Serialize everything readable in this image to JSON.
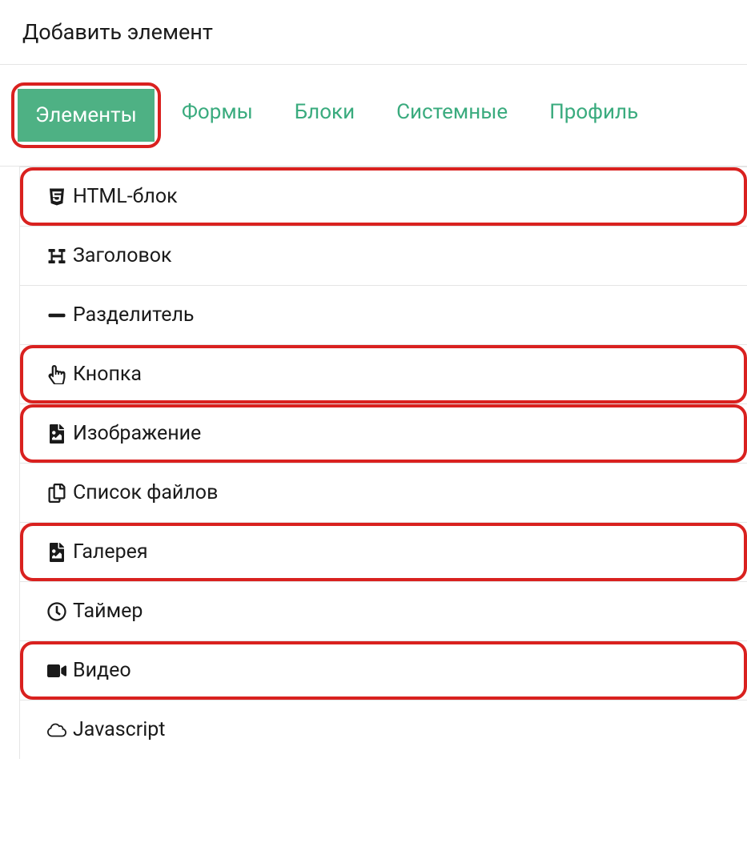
{
  "header": {
    "title": "Добавить элемент"
  },
  "tabs": [
    {
      "label": "Элементы",
      "active": true,
      "highlighted": true
    },
    {
      "label": "Формы",
      "active": false,
      "highlighted": false
    },
    {
      "label": "Блоки",
      "active": false,
      "highlighted": false
    },
    {
      "label": "Системные",
      "active": false,
      "highlighted": false
    },
    {
      "label": "Профиль",
      "active": false,
      "highlighted": false
    }
  ],
  "items": [
    {
      "label": "HTML-блок",
      "icon": "html5-icon",
      "highlighted": true
    },
    {
      "label": "Заголовок",
      "icon": "heading-icon",
      "highlighted": false
    },
    {
      "label": "Разделитель",
      "icon": "minus-icon",
      "highlighted": false
    },
    {
      "label": "Кнопка",
      "icon": "hand-pointer-icon",
      "highlighted": true
    },
    {
      "label": "Изображение",
      "icon": "image-icon",
      "highlighted": true
    },
    {
      "label": "Список файлов",
      "icon": "copy-icon",
      "highlighted": false
    },
    {
      "label": "Галерея",
      "icon": "image-icon",
      "highlighted": true
    },
    {
      "label": "Таймер",
      "icon": "clock-icon",
      "highlighted": false
    },
    {
      "label": "Видео",
      "icon": "video-icon",
      "highlighted": true
    },
    {
      "label": "Javascript",
      "icon": "cloud-icon",
      "highlighted": false
    }
  ]
}
